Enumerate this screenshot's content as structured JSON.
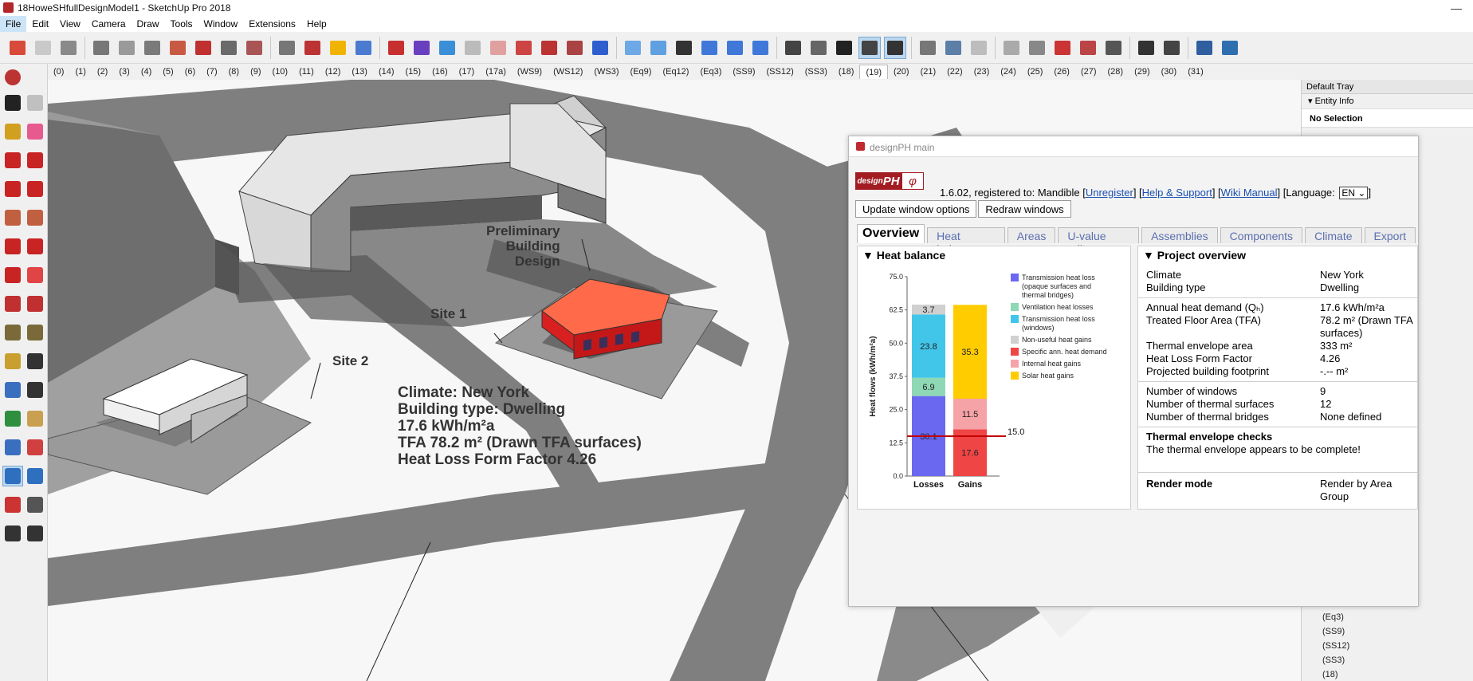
{
  "window": {
    "title": "18HoweSHfullDesignModel1 - SketchUp Pro 2018"
  },
  "menu": [
    "File",
    "Edit",
    "View",
    "Camera",
    "Draw",
    "Tools",
    "Window",
    "Extensions",
    "Help"
  ],
  "scenes": [
    "(0)",
    "(1)",
    "(2)",
    "(3)",
    "(4)",
    "(5)",
    "(6)",
    "(7)",
    "(8)",
    "(9)",
    "(10)",
    "(11)",
    "(12)",
    "(13)",
    "(14)",
    "(15)",
    "(16)",
    "(17)",
    "(17a)",
    "(WS9)",
    "(WS12)",
    "(WS3)",
    "(Eq9)",
    "(Eq12)",
    "(Eq3)",
    "(SS9)",
    "(SS12)",
    "(SS3)",
    "(18)",
    "(19)",
    "(20)",
    "(21)",
    "(22)",
    "(23)",
    "(24)",
    "(25)",
    "(26)",
    "(27)",
    "(28)",
    "(29)",
    "(30)",
    "(31)"
  ],
  "active_scene": "(19)",
  "viewport": {
    "label_preliminary": "Preliminary\nBuilding\nDesign",
    "label_site1": "Site 1",
    "label_site2": "Site 2",
    "info": [
      "Climate: New York",
      "Building type: Dwelling",
      "17.6 kWh/m²a",
      "TFA  78.2 m² (Drawn TFA surfaces)",
      "Heat Loss Form Factor 4.26"
    ]
  },
  "tray": {
    "title": "Default Tray",
    "panel": "Entity Info",
    "selection": "No Selection",
    "scenes": [
      "(Eq3)",
      "(SS9)",
      "(SS12)",
      "(SS3)",
      "(18)"
    ]
  },
  "dph": {
    "title": "designPH main",
    "logo_a": "design",
    "logo_b": "PH",
    "logo_c": "φ",
    "version": "1.6.02, registered to: Mandible",
    "links": [
      "Unregister",
      "Help & Support",
      "Wiki Manual"
    ],
    "language_label": "[Language:",
    "language": "EN",
    "buttons": [
      "Update window options",
      "Redraw windows"
    ],
    "tabs": [
      "Overview",
      "Heat balance",
      "Areas",
      "U-value editor",
      "Assemblies",
      "Components",
      "Climate",
      "Export"
    ],
    "heat_balance_title": "▼ Heat balance",
    "overview_title": "▼ Project overview",
    "overview_rows": [
      {
        "k": "Climate",
        "v": "New York"
      },
      {
        "k": "Building type",
        "v": "Dwelling"
      },
      {
        "k": "Annual heat demand (Qₕ)",
        "v": "17.6 kWh/m²a"
      },
      {
        "k": "Treated Floor Area (TFA)",
        "v": "78.2 m² (Drawn TFA surfaces)"
      },
      {
        "k": "Thermal envelope area",
        "v": "333 m²"
      },
      {
        "k": "Heat Loss Form Factor",
        "v": "4.26"
      },
      {
        "k": "Projected building footprint",
        "v": "-.-- m²"
      },
      {
        "k": "Number of windows",
        "v": "9"
      },
      {
        "k": "Number of thermal surfaces",
        "v": "12"
      },
      {
        "k": "Number of thermal bridges",
        "v": "None defined"
      }
    ],
    "envelope_title": "Thermal envelope checks",
    "envelope_msg": "The thermal envelope appears to be complete!",
    "render_label": "Render mode",
    "render_value": "Render by Area Group"
  },
  "chart_data": {
    "type": "bar",
    "stacked": true,
    "categories": [
      "Losses",
      "Gains"
    ],
    "ylabel": "Heat flows (kWh/m²a)",
    "ylim": [
      0,
      75
    ],
    "yticks": [
      "0.0",
      "12.5",
      "25.0",
      "37.5",
      "50.0",
      "62.5",
      "75.0"
    ],
    "target_line": 15.0,
    "target_label": "15.0",
    "series": [
      {
        "name": "Transmission heat loss (opaque surfaces and thermal bridges)",
        "color": "#6a68f0",
        "values": [
          30.1,
          0
        ]
      },
      {
        "name": "Ventilation heat losses",
        "color": "#8fd8b5",
        "values": [
          6.9,
          0
        ]
      },
      {
        "name": "Transmission heat loss (windows)",
        "color": "#41c6ea",
        "values": [
          23.8,
          0
        ]
      },
      {
        "name": "Non-useful heat gains",
        "color": "#d0d0d0",
        "values": [
          3.7,
          0
        ]
      },
      {
        "name": "Specific ann. heat demand",
        "color": "#f04545",
        "values": [
          0,
          17.6
        ]
      },
      {
        "name": "Internal heat gains",
        "color": "#f5a3a7",
        "values": [
          0,
          11.5
        ]
      },
      {
        "name": "Solar heat gains",
        "color": "#ffcc00",
        "values": [
          0,
          35.3
        ]
      }
    ],
    "data_labels": [
      {
        "series": 0,
        "cat": 0,
        "text": "30.1"
      },
      {
        "series": 1,
        "cat": 0,
        "text": "6.9"
      },
      {
        "series": 2,
        "cat": 0,
        "text": "23.8"
      },
      {
        "series": 3,
        "cat": 0,
        "text": "3.7"
      },
      {
        "series": 4,
        "cat": 1,
        "text": "17.6"
      },
      {
        "series": 5,
        "cat": 1,
        "text": "11.5"
      },
      {
        "series": 6,
        "cat": 1,
        "text": "35.3"
      }
    ],
    "legend": [
      "Transmission heat loss",
      "(opaque surfaces and",
      "thermal bridges)",
      "Ventilation heat losses",
      "Transmission heat loss",
      "(windows)",
      "Non-useful heat gains",
      "Specific ann. heat demand",
      "Internal heat gains",
      "Solar heat gains"
    ]
  }
}
